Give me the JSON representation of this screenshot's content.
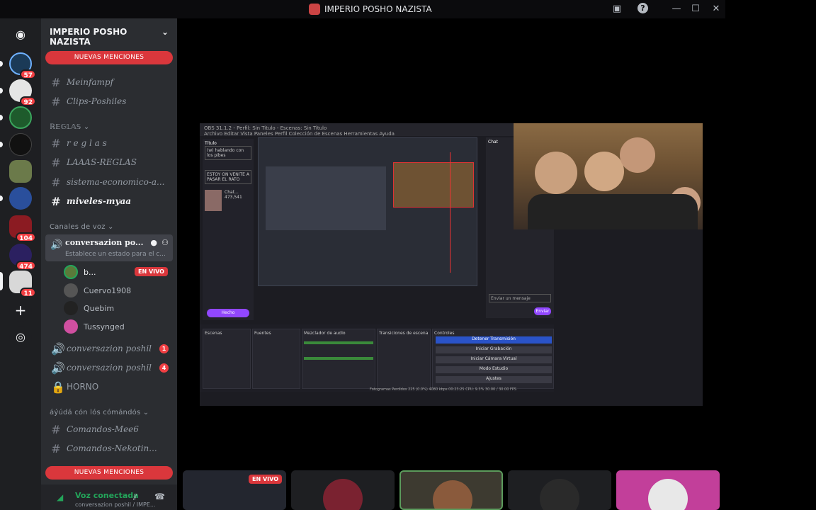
{
  "window": {
    "title": "IMPERIO POSHO NAZISTA"
  },
  "rail": {
    "badges": [
      "57",
      "92",
      "104",
      "474",
      "11"
    ]
  },
  "sidebar": {
    "guild_name": "IMPERIO POSHO NAZISTA",
    "new_mentions": "NUEVAS MENCIONES",
    "channels_top": [
      {
        "name": "Meinfampf"
      },
      {
        "name": "Clips-Poshiles"
      }
    ],
    "rules_category": "ℝ𝔼𝔾𝕃𝔸𝕊",
    "channels_rules": [
      {
        "name": "r e g l a s"
      },
      {
        "name": "LAAAS-REGLAS"
      },
      {
        "name": "sistema-economico-a..."
      },
      {
        "name": "miveles-myaa"
      }
    ],
    "voice_category": "Canales de voz",
    "active_voice": {
      "name": "conversazion po...",
      "status": "Establece un estado para el c..."
    },
    "voice_users": [
      {
        "name": "b...",
        "live": "EN VIVO"
      },
      {
        "name": "Cuervo1908"
      },
      {
        "name": "Quebim"
      },
      {
        "name": "Tussynged"
      }
    ],
    "voice_channels": [
      {
        "name": "conversazion poshil",
        "badge": "1"
      },
      {
        "name": "conversazion poshil",
        "badge": "4"
      },
      {
        "name": "HORNO"
      }
    ],
    "help_category": "áýúdá cón lós cómándós",
    "channels_help": [
      {
        "name": "Comandos-Mee6"
      },
      {
        "name": "Comandos-Nekotin..."
      }
    ],
    "voice_panel": {
      "status": "Voz conectada",
      "channel": "conversazion poshil / IMPE..."
    }
  },
  "stream": {
    "obs_title": "OBS 31.1.2 - Perfil: Sin Titulo - Escenas: Sin Titulo",
    "obs_menu": "Archivo  Editar  Vista  Paneles  Perfil  Colección de Escenas  Herramientas  Ayuda",
    "stream_title": "(w) hablando con los pibes",
    "notify_text": "ESTOY ON VENITE A PASAR EL RATO",
    "category": "Chat...",
    "viewers": "473,541",
    "done_button": "Hecho",
    "chat_title": "Chat",
    "send_placeholder": "Enviar un mensaje",
    "send_button": "Enviar",
    "docks": [
      "Escenas",
      "Fuentes",
      "Mezclador de audio",
      "Transiciones de escena",
      "Controles"
    ],
    "controls": [
      "Detener Transmisión",
      "Iniciar Grabación",
      "Iniciar Cámara Virtual",
      "Modo Estudio",
      "Ajustes"
    ],
    "status_bar": "Fotogramas Perdidos 225 (0.0%)   4080 kbps   00:23:25   CPU: 9.3%   30.00 / 30.00 FPS"
  },
  "tiles": {
    "live": "EN VIVO"
  }
}
